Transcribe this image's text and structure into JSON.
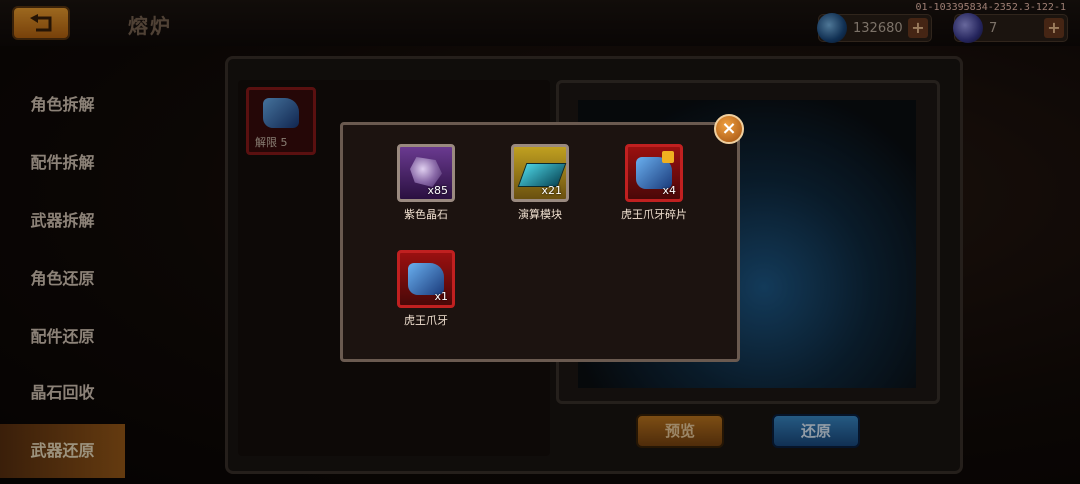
{
  "header": {
    "title": "熔炉",
    "version": "01-103395834-2352.3-122-1",
    "resources": [
      {
        "value": "132680",
        "plus": "+"
      },
      {
        "value": "7",
        "plus": "+"
      }
    ]
  },
  "sidebar": {
    "items": [
      {
        "label": "角色拆解"
      },
      {
        "label": "配件拆解"
      },
      {
        "label": "武器拆解"
      },
      {
        "label": "角色还原"
      },
      {
        "label": "配件还原"
      },
      {
        "label": "晶石回收"
      },
      {
        "label": "武器还原"
      }
    ],
    "active_index": 6
  },
  "slot": {
    "label": "解限 5"
  },
  "buttons": {
    "preview": "预览",
    "restore": "还原"
  },
  "popup": {
    "close": "×",
    "items": [
      {
        "name": "紫色晶石",
        "count": "x85",
        "icon": "purple-crystal-icon"
      },
      {
        "name": "演算模块",
        "count": "x21",
        "icon": "compute-module-icon"
      },
      {
        "name": "虎王爪牙碎片",
        "count": "x4",
        "icon": "tiger-claw-shard-icon"
      },
      {
        "name": "虎王爪牙",
        "count": "x1",
        "icon": "tiger-claw-icon"
      }
    ]
  }
}
